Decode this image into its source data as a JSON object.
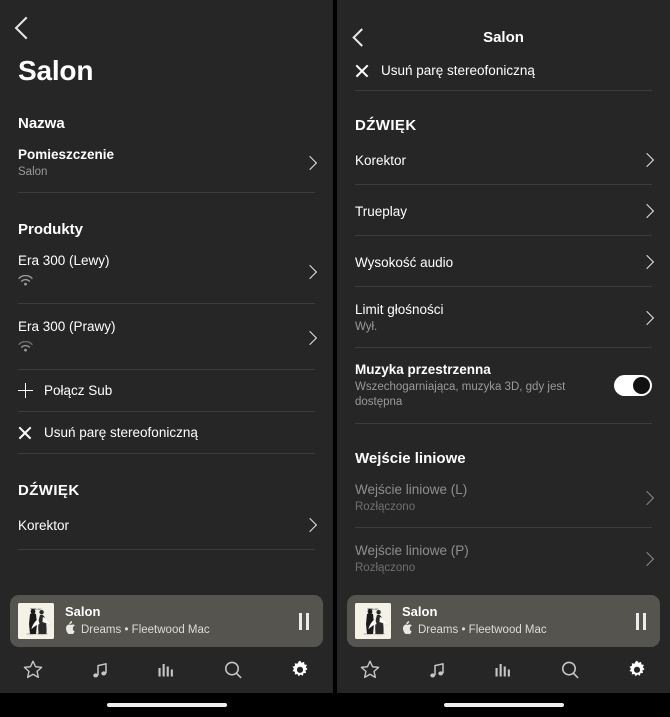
{
  "app": {
    "accent_text": "#ffffff",
    "background": "#262626",
    "divider": "#3c3c3c",
    "nowplaying_bg": "#56544f",
    "muted_text": "#9a9a9a",
    "disabled_text": "#8e8e8e"
  },
  "left": {
    "back_icon": "chevron-left-icon",
    "title": "Salon",
    "sections": [
      {
        "heading": "Nazwa"
      },
      {
        "heading": "Produkty"
      },
      {
        "heading": "DŹWIĘK"
      }
    ],
    "name_row": {
      "label": "Pomieszczenie",
      "value": "Salon",
      "chevron": "chevron-right-icon"
    },
    "products": [
      {
        "label": "Era 300 (Lewy)",
        "status_icon": "wifi-icon",
        "chevron": "chevron-right-icon"
      },
      {
        "label": "Era 300 (Prawy)",
        "status_icon": "wifi-icon",
        "chevron": "chevron-right-icon"
      }
    ],
    "actions": [
      {
        "icon": "plus-icon",
        "label": "Połącz Sub"
      },
      {
        "icon": "close-icon",
        "label": "Usuń parę stereofoniczną"
      }
    ],
    "sound_rows": [
      {
        "label": "Korektor",
        "chevron": "chevron-right-icon"
      }
    ]
  },
  "right": {
    "back_icon": "chevron-left-icon",
    "title": "Salon",
    "remove_pair": {
      "icon": "close-icon",
      "label": "Usuń parę stereofoniczną"
    },
    "sound_heading": "DŹWIĘK",
    "sound_rows": [
      {
        "label": "Korektor",
        "sub": "",
        "chevron": "chevron-right-icon"
      },
      {
        "label": "Trueplay",
        "sub": "",
        "chevron": "chevron-right-icon"
      },
      {
        "label": "Wysokość audio",
        "sub": "",
        "chevron": "chevron-right-icon"
      },
      {
        "label": "Limit głośności",
        "sub": "Wył.",
        "chevron": "chevron-right-icon"
      }
    ],
    "spatial": {
      "label": "Muzyka przestrzenna",
      "sub": "Wszechogarniająca, muzyka 3D, gdy jest dostępna",
      "toggle_state": "on"
    },
    "line_in_heading": "Wejście liniowe",
    "line_in_rows": [
      {
        "label": "Wejście liniowe (L)",
        "sub": "Rozłączono",
        "chevron": "chevron-right-icon"
      },
      {
        "label": "Wejście liniowe (P)",
        "sub": "Rozłączono",
        "chevron": "chevron-right-icon"
      }
    ]
  },
  "now_playing": {
    "room": "Salon",
    "source_icon": "apple-music-icon",
    "track": "Dreams",
    "artist": "Fleetwood Mac",
    "subtitle": "Dreams • Fleetwood Mac",
    "transport_icon": "pause-icon",
    "artwork_alt": "album-artwork"
  },
  "nav": {
    "items": [
      {
        "icon": "star-icon",
        "name": "favorites",
        "active": false
      },
      {
        "icon": "music-note-icon",
        "name": "browse",
        "active": false
      },
      {
        "icon": "equalizer-bars-icon",
        "name": "now-playing",
        "active": false
      },
      {
        "icon": "search-icon",
        "name": "search",
        "active": false
      },
      {
        "icon": "gear-icon",
        "name": "settings",
        "active": true
      }
    ]
  }
}
